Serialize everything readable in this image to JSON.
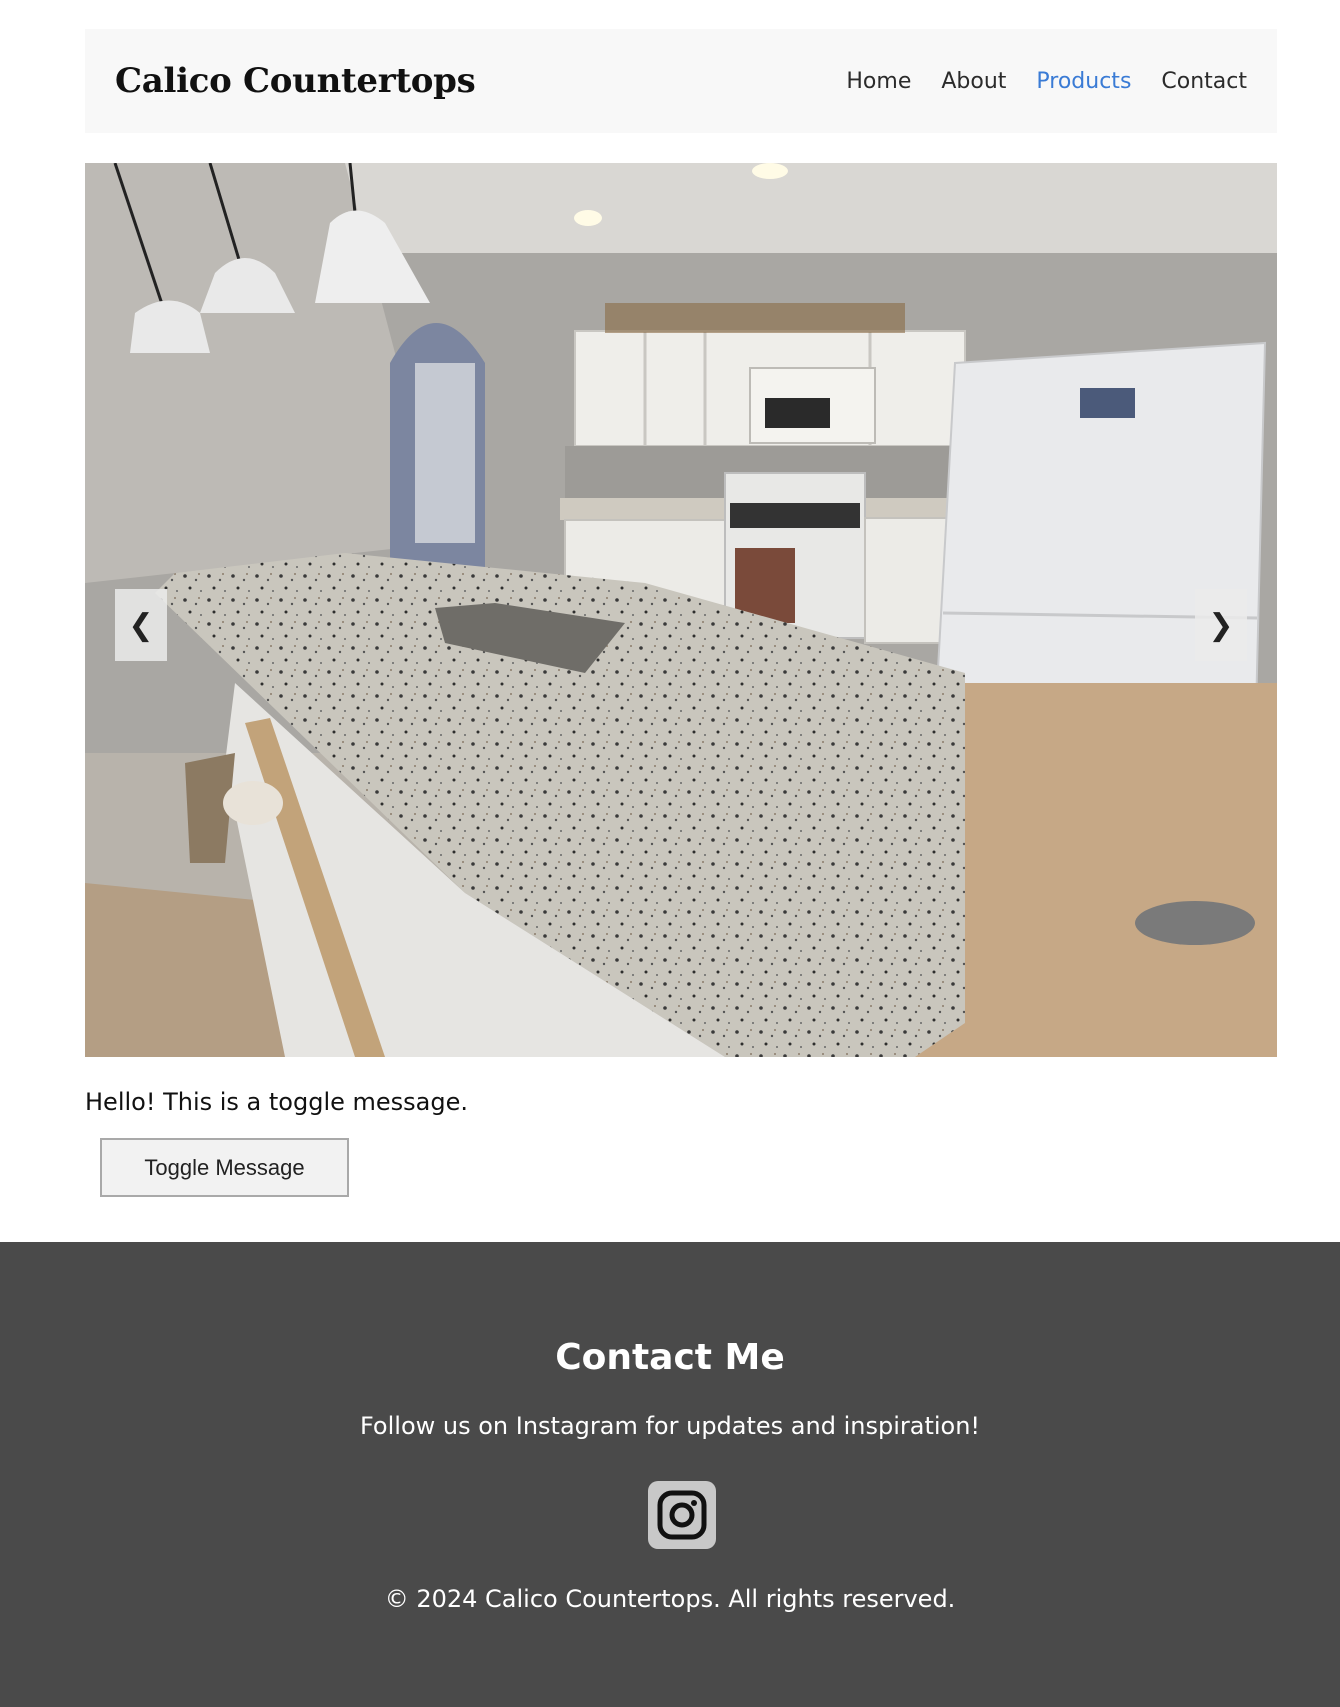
{
  "header": {
    "logo": "Calico Countertops",
    "nav": [
      {
        "label": "Home",
        "active": false
      },
      {
        "label": "About",
        "active": false
      },
      {
        "label": "Products",
        "active": true
      },
      {
        "label": "Contact",
        "active": false
      }
    ]
  },
  "carousel": {
    "prev_label": "❮",
    "next_label": "❯",
    "image_description": "kitchen-granite-countertop-photo"
  },
  "toggle": {
    "message": "Hello! This is a toggle message.",
    "button_label": "Toggle Message"
  },
  "footer": {
    "title": "Contact Me",
    "follow_text": "Follow us on Instagram for updates and inspiration!",
    "instagram_icon": "instagram-icon",
    "copyright": "© 2024 Calico Countertops. All rights reserved."
  },
  "colors": {
    "nav_active": "#3a7bd5",
    "header_bg": "#f8f8f8",
    "footer_bg": "#4a4a4a"
  }
}
